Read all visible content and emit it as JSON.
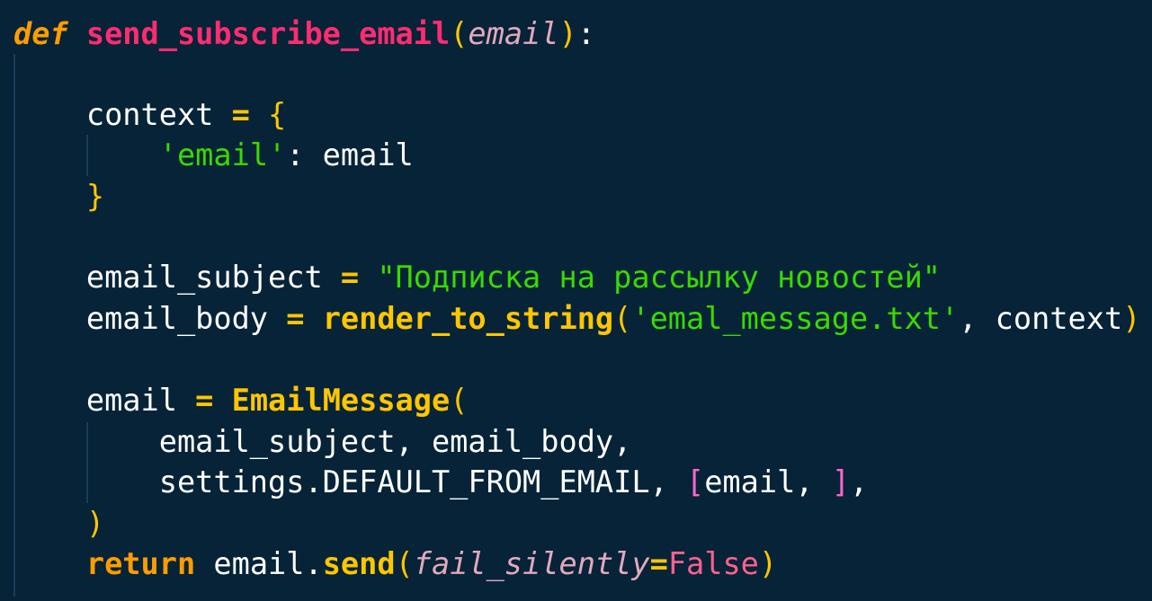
{
  "editor": {
    "language": "python",
    "theme_colors": {
      "background": "#062338",
      "keyword": "#ff9d00",
      "function_def": "#ff2c70",
      "function_call": "#ffc600",
      "string": "#3ad900",
      "parameter": "#e2a9bd",
      "constant": "#ff628c",
      "text": "#ffffff"
    },
    "lines": [
      {
        "tokens": [
          {
            "t": "def",
            "c": "kw-def"
          },
          {
            "t": " ",
            "c": "plain"
          },
          {
            "t": "send_subscribe_email",
            "c": "fn-def"
          },
          {
            "t": "(",
            "c": "punct-y"
          },
          {
            "t": "email",
            "c": "param"
          },
          {
            "t": ")",
            "c": "punct-y"
          },
          {
            "t": ":",
            "c": "plain"
          }
        ]
      },
      {
        "tokens": []
      },
      {
        "tokens": [
          {
            "t": "    context ",
            "c": "plain"
          },
          {
            "t": "=",
            "c": "op"
          },
          {
            "t": " ",
            "c": "plain"
          },
          {
            "t": "{",
            "c": "punct-y"
          }
        ]
      },
      {
        "tokens": [
          {
            "t": "        ",
            "c": "plain"
          },
          {
            "t": "'email'",
            "c": "str"
          },
          {
            "t": ": email",
            "c": "plain"
          }
        ]
      },
      {
        "tokens": [
          {
            "t": "    ",
            "c": "plain"
          },
          {
            "t": "}",
            "c": "punct-y"
          }
        ]
      },
      {
        "tokens": []
      },
      {
        "tokens": [
          {
            "t": "    email_subject ",
            "c": "plain"
          },
          {
            "t": "=",
            "c": "op"
          },
          {
            "t": " ",
            "c": "plain"
          },
          {
            "t": "\"Подписка на рассылку новостей\"",
            "c": "str"
          }
        ]
      },
      {
        "tokens": [
          {
            "t": "    email_body ",
            "c": "plain"
          },
          {
            "t": "=",
            "c": "op"
          },
          {
            "t": " ",
            "c": "plain"
          },
          {
            "t": "render_to_string",
            "c": "fn"
          },
          {
            "t": "(",
            "c": "punct-y"
          },
          {
            "t": "'emal_message.txt'",
            "c": "str"
          },
          {
            "t": ", context",
            "c": "plain"
          },
          {
            "t": ")",
            "c": "punct-y"
          }
        ]
      },
      {
        "tokens": []
      },
      {
        "tokens": [
          {
            "t": "    email ",
            "c": "plain"
          },
          {
            "t": "=",
            "c": "op"
          },
          {
            "t": " ",
            "c": "plain"
          },
          {
            "t": "EmailMessage",
            "c": "fn"
          },
          {
            "t": "(",
            "c": "punct-y"
          }
        ]
      },
      {
        "tokens": [
          {
            "t": "        email_subject, email_body,",
            "c": "plain"
          }
        ]
      },
      {
        "tokens": [
          {
            "t": "        settings.DEFAULT_FROM_EMAIL, ",
            "c": "plain"
          },
          {
            "t": "[",
            "c": "bracket-p"
          },
          {
            "t": "email, ",
            "c": "plain"
          },
          {
            "t": "]",
            "c": "bracket-p"
          },
          {
            "t": ",",
            "c": "plain"
          }
        ]
      },
      {
        "tokens": [
          {
            "t": "    ",
            "c": "plain"
          },
          {
            "t": ")",
            "c": "punct-y"
          }
        ]
      },
      {
        "tokens": [
          {
            "t": "    ",
            "c": "plain"
          },
          {
            "t": "return",
            "c": "kw"
          },
          {
            "t": " email.",
            "c": "plain"
          },
          {
            "t": "send",
            "c": "fn"
          },
          {
            "t": "(",
            "c": "punct-y"
          },
          {
            "t": "fail_silently",
            "c": "param"
          },
          {
            "t": "=",
            "c": "op"
          },
          {
            "t": "False",
            "c": "const"
          },
          {
            "t": ")",
            "c": "punct-y"
          }
        ]
      }
    ]
  }
}
